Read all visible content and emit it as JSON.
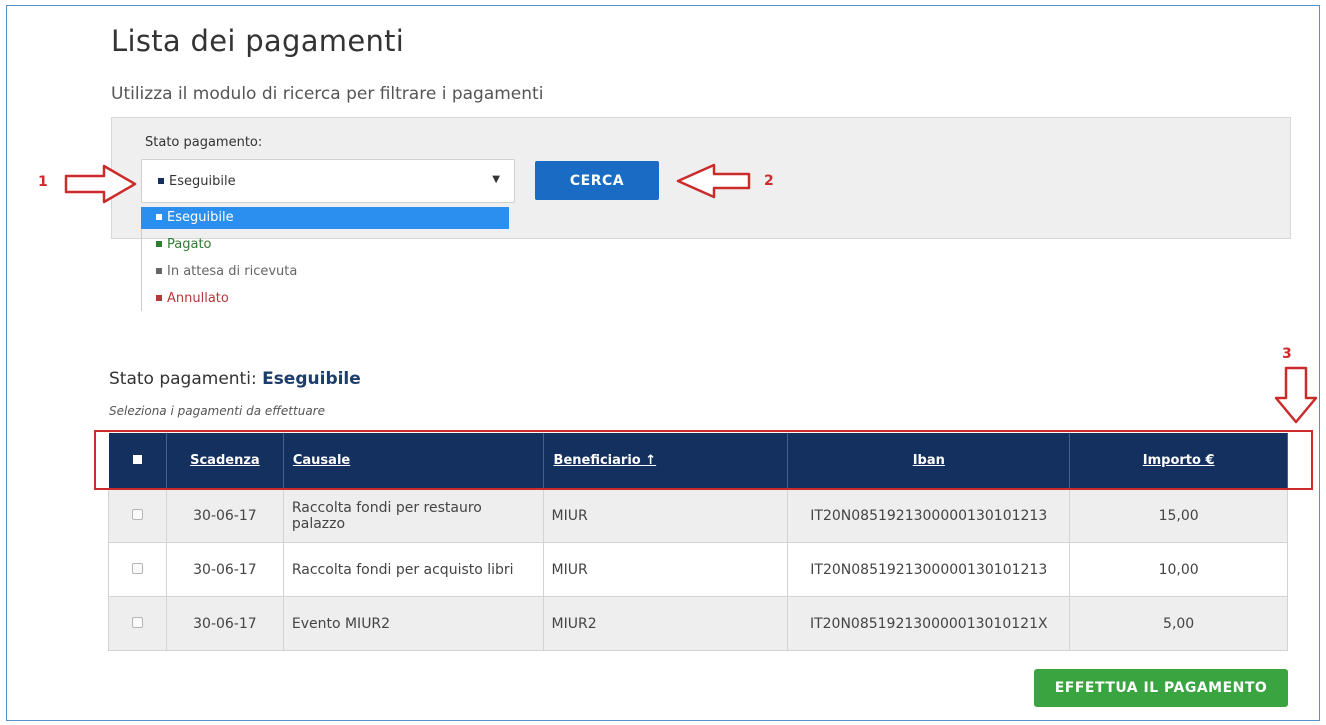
{
  "page": {
    "title": "Lista dei pagamenti",
    "subtitle": "Utilizza il modulo di ricerca per filtrare i pagamenti"
  },
  "search": {
    "label": "Stato pagamento:",
    "selected_value": "Eseguibile",
    "options": [
      {
        "label": "Eseguibile",
        "color": "#14305e"
      },
      {
        "label": "Pagato",
        "color": "#2e7d32"
      },
      {
        "label": "In attesa di ricevuta",
        "color": "#666666"
      },
      {
        "label": "Annullato",
        "color": "#b23a3a"
      }
    ],
    "button_label": "CERCA"
  },
  "annotations": [
    "1",
    "2",
    "3"
  ],
  "results": {
    "heading_prefix": "Stato pagamenti: ",
    "heading_value": "Eseguibile",
    "hint": "Seleziona i pagamenti da effettuare",
    "columns": [
      "Scadenza",
      "Causale",
      "Beneficiario ↑",
      "Iban",
      "Importo €"
    ],
    "rows": [
      {
        "scadenza": "30-06-17",
        "causale": "Raccolta fondi per restauro palazzo",
        "beneficiario": "MIUR",
        "iban": "IT20N0851921300000130101213",
        "importo": "15,00"
      },
      {
        "scadenza": "30-06-17",
        "causale": "Raccolta fondi per acquisto libri",
        "beneficiario": "MIUR",
        "iban": "IT20N0851921300000130101213",
        "importo": "10,00"
      },
      {
        "scadenza": "30-06-17",
        "causale": "Evento MIUR2",
        "beneficiario": "MIUR2",
        "iban": "IT20N085192130000013010121X",
        "importo": "5,00"
      }
    ]
  },
  "actions": {
    "pay_button": "EFFETTUA IL PAGAMENTO"
  },
  "colors": {
    "header": "#14305e",
    "cerca": "#1a6bc4",
    "pay": "#3aa441",
    "annotation": "#cc2b2b",
    "highlight": "#2b8ff0"
  }
}
